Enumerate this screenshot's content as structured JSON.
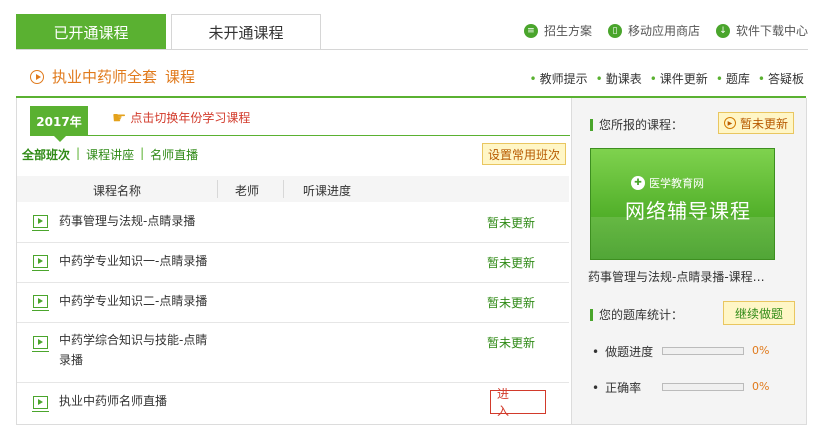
{
  "tabs": {
    "active": "已开通课程",
    "inactive": "未开通课程"
  },
  "top_links": [
    {
      "label": "招生方案",
      "icon": "clipboard-icon"
    },
    {
      "label": "移动应用商店",
      "icon": "mobile-icon"
    },
    {
      "label": "软件下载中心",
      "icon": "download-icon"
    }
  ],
  "header": {
    "course": "执业中药师全套",
    "suffix": "课程",
    "links": [
      "教师提示",
      "勤课表",
      "课件更新",
      "题库",
      "答疑板"
    ]
  },
  "year": {
    "label": "2017年",
    "switch_hint": "点击切换年份学习课程"
  },
  "filters": {
    "all": "全部班次",
    "lecture": "课程讲座",
    "live": "名师直播"
  },
  "set_button": "设置常用班次",
  "table": {
    "headers": [
      "课程名称",
      "老师",
      "听课进度"
    ],
    "rows": [
      {
        "name": "药事管理与法规-点睛录播",
        "status": "暂未更新"
      },
      {
        "name": "中药学专业知识一-点睛录播",
        "status": "暂未更新"
      },
      {
        "name": "中药学专业知识二-点睛录播",
        "status": "暂未更新"
      },
      {
        "name_line1": "中药学综合知识与技能-点睛",
        "name_line2": "录播",
        "status": "暂未更新"
      },
      {
        "name": "执业中药师名师直播",
        "action": "进 入"
      }
    ]
  },
  "right": {
    "enrolled_label": "您所报的课程：",
    "enrolled_status": "暂未更新",
    "banner_logo": "医学教育网",
    "banner_text": "网络辅导课程",
    "course_title": "药事管理与法规-点睛录播-课程…",
    "bank_label": "您的题库统计：",
    "continue_button": "继续做题",
    "stats": [
      {
        "label": "做题进度",
        "value": "0%",
        "fraction": 0
      },
      {
        "label": "正确率",
        "value": "0%",
        "fraction": 0
      }
    ]
  },
  "colors": {
    "green": "#5ab131",
    "orange": "#e07a1c",
    "red": "#d23a2b"
  }
}
